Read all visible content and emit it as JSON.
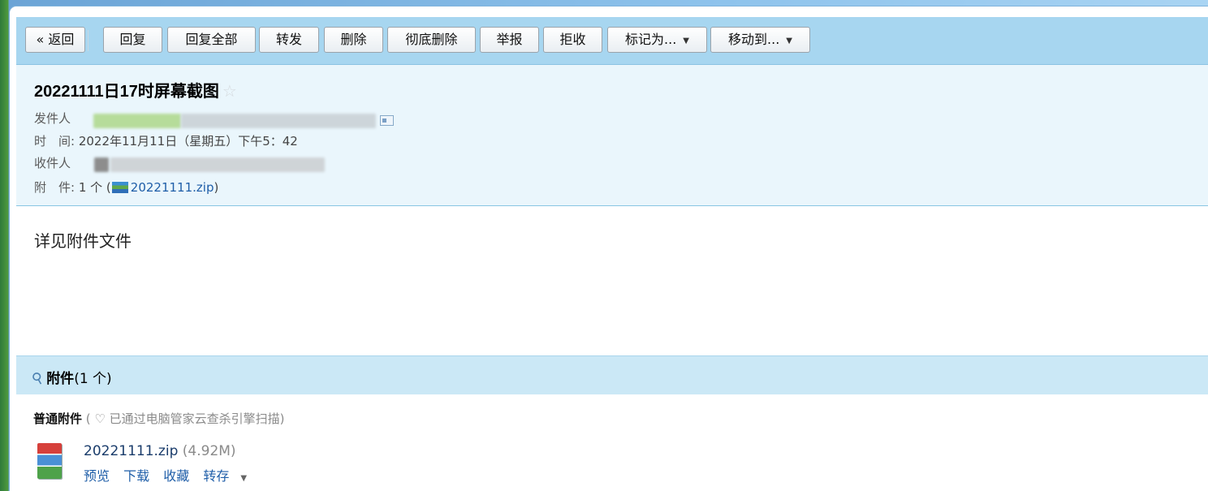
{
  "toolbar": {
    "back": "« 返回",
    "reply": "回复",
    "reply_all": "回复全部",
    "forward": "转发",
    "delete": "删除",
    "delete_permanently": "彻底删除",
    "report": "举报",
    "reject": "拒收",
    "mark_as": "标记为...",
    "move_to": "移动到..."
  },
  "email": {
    "subject": "20221111日17时屏幕截图",
    "star": "☆",
    "sender_label": "发件人",
    "time_label": "时　间:",
    "time_value": "2022年11月11日（星期五）下午5：42",
    "recipient_label": "收件人",
    "attachment_label": "附　件:",
    "attachment_count": "1 个 (",
    "attachment_name": "20221111.zip",
    "attachment_close": ")",
    "body": "详见附件文件"
  },
  "attachments": {
    "title": "附件",
    "count": "(1 个)",
    "type_label": "普通附件",
    "scan_note": "( ♡ 已通过电脑管家云查杀引擎扫描)",
    "files": [
      {
        "name": "20221111.zip",
        "size": "(4.92M)",
        "actions": {
          "preview": "预览",
          "download": "下载",
          "favorite": "收藏",
          "save_to": "转存"
        }
      }
    ]
  },
  "colors": {
    "toolbar_bg": "#a7d6f0",
    "header_bg": "#eaf6fc",
    "attach_bg": "#cbe8f6",
    "link": "#1f5ea8"
  }
}
